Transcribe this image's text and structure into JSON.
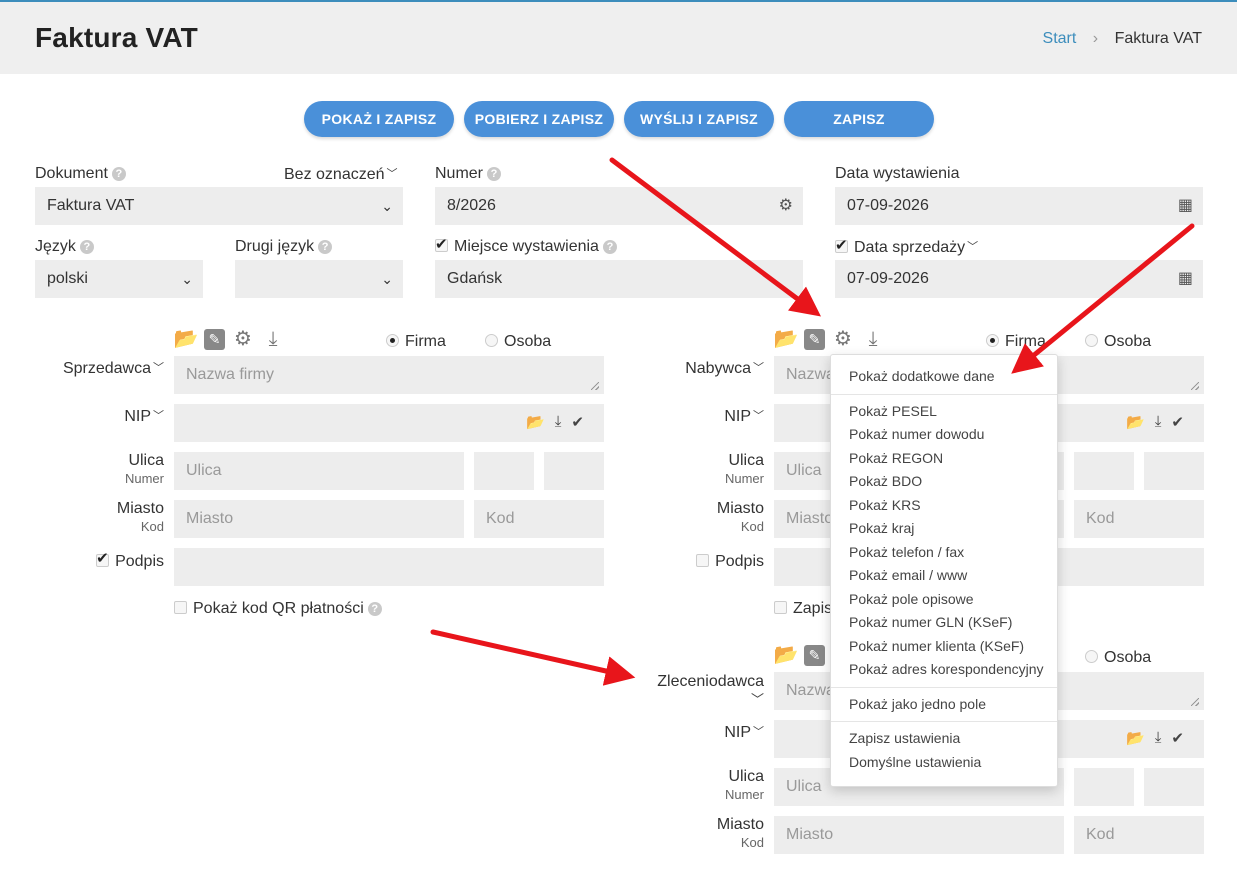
{
  "header": {
    "title": "Faktura VAT",
    "breadcrumb": {
      "home": "Start",
      "current": "Faktura VAT"
    }
  },
  "actions": {
    "show_save": "POKAŻ I ZAPISZ",
    "download_save": "POBIERZ I ZAPISZ",
    "send_save": "WYŚLIJ I ZAPISZ",
    "save": "ZAPISZ"
  },
  "document": {
    "label": "Dokument",
    "marking": "Bez oznaczeń",
    "value": "Faktura VAT"
  },
  "number": {
    "label": "Numer",
    "value": "8/2026"
  },
  "issue_date": {
    "label": "Data wystawienia",
    "value": "07-09-2026"
  },
  "language": {
    "label": "Język",
    "value": "polski"
  },
  "second_language": {
    "label": "Drugi język",
    "value": ""
  },
  "place": {
    "label": "Miejsce wystawienia",
    "value": "Gdańsk"
  },
  "sale_date": {
    "label": "Data sprzedaży",
    "value": "07-09-2026"
  },
  "party_labels": {
    "company": "Firma",
    "person": "Osoba",
    "nip": "NIP",
    "street": "Ulica",
    "number": "Numer",
    "city": "Miasto",
    "code": "Kod",
    "signature": "Podpis"
  },
  "placeholders": {
    "company_name": "Nazwa firmy",
    "street": "Ulica",
    "city": "Miasto",
    "code": "Kod",
    "name_short": "Nazwa"
  },
  "seller": {
    "label": "Sprzedawca"
  },
  "buyer": {
    "label": "Nabywca",
    "company_partial": "Firma"
  },
  "principal": {
    "label": "Zleceniodawca",
    "signature_partial": "Zapis"
  },
  "qr": {
    "label": "Pokaż kod QR płatności"
  },
  "dropdown_menu": {
    "group1": [
      "Pokaż dodatkowe dane"
    ],
    "group2": [
      "Pokaż PESEL",
      "Pokaż numer dowodu",
      "Pokaż REGON",
      "Pokaż BDO",
      "Pokaż KRS",
      "Pokaż kraj",
      "Pokaż telefon / fax",
      "Pokaż email / www",
      "Pokaż pole opisowe",
      "Pokaż numer GLN (KSeF)",
      "Pokaż numer klienta (KSeF)",
      "Pokaż adres korespondencyjny"
    ],
    "group3": [
      "Pokaż jako jedno pole"
    ],
    "group4": [
      "Zapisz ustawienia",
      "Domyślne ustawienia"
    ]
  },
  "colors": {
    "accent": "#4a90d9",
    "link": "#3c8dbc",
    "field_bg": "#ededed",
    "annotation_arrow": "#e8151b"
  }
}
